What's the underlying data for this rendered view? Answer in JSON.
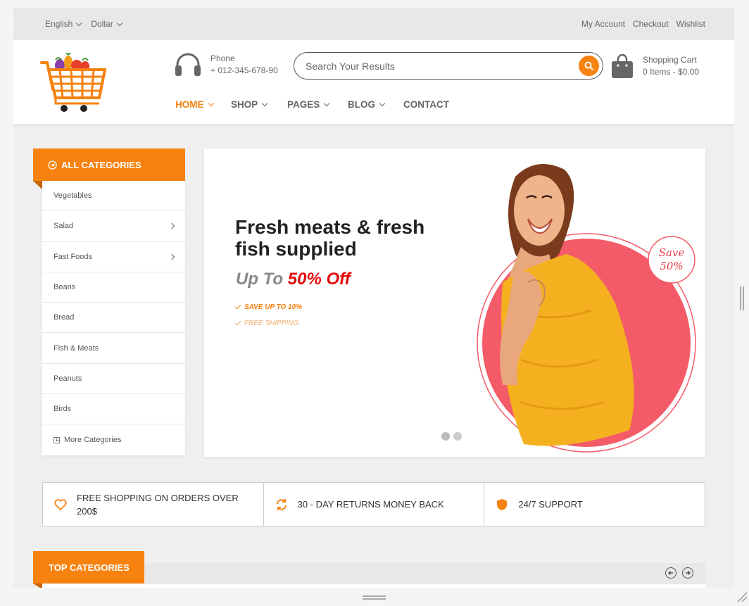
{
  "topbar": {
    "language": "English",
    "currency": "Dollar",
    "links": [
      "My Account",
      "Checkout",
      "Wishlist"
    ]
  },
  "header": {
    "phone_label": "Phone",
    "phone_number": "+ 012-345-678-90",
    "search_placeholder": "Search Your Results",
    "cart_label": "Shopping Cart",
    "cart_summary": "0 Items - $0.00"
  },
  "nav": [
    "HOME",
    "SHOP",
    "PAGES",
    "BLOG",
    "CONTACT"
  ],
  "categories": {
    "title": "ALL CATEGORIES",
    "items": [
      "Vegetables",
      "Salad",
      "Fast Foods",
      "Beans",
      "Bread",
      "Fish & Meats",
      "Peanuts",
      "Birds"
    ],
    "more": "More Categories"
  },
  "hero": {
    "headline": "Fresh meats & fresh fish supplied",
    "upto": "Up To",
    "discount": "50% Off",
    "feature_1": "SAVE UP TO 10%",
    "feature_2": "FREE SHIPPING",
    "badge_line1": "Save",
    "badge_line2": "50%",
    "slide_count": 2,
    "active_slide": 1
  },
  "features": [
    "FREE SHOPPING ON ORDERS OVER 200$",
    "30 - DAY RETURNS MONEY BACK",
    "24/7 SUPPORT"
  ],
  "top_categories": {
    "title": "TOP CATEGORIES"
  },
  "colors": {
    "accent": "#f7820f",
    "sale_red": "#e60a0a",
    "circle_pink": "#f45b69"
  }
}
